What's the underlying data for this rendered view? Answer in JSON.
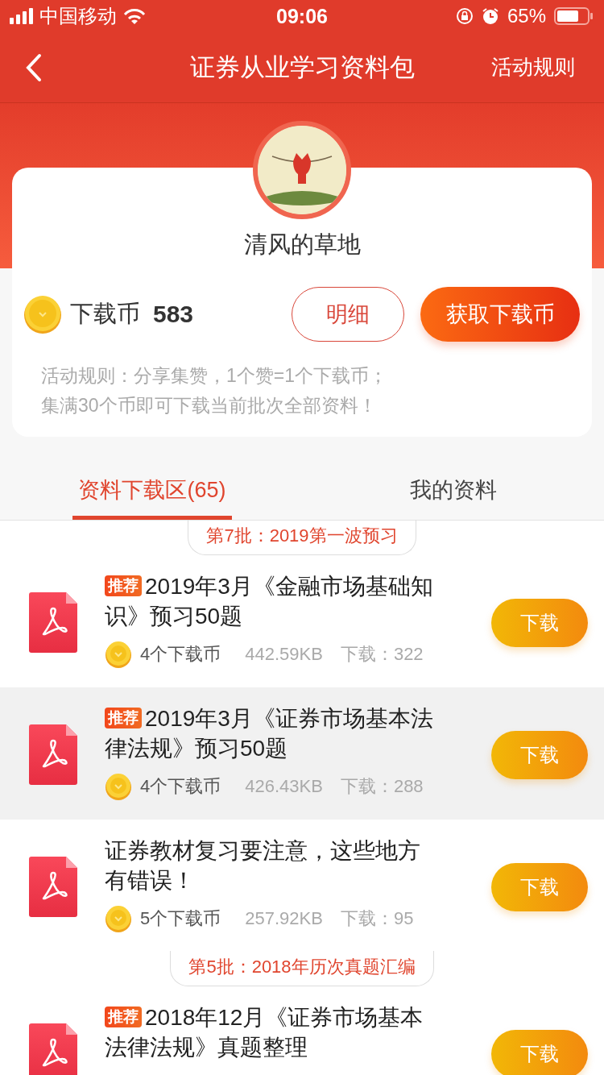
{
  "status_bar": {
    "carrier": "中国移动",
    "time": "09:06",
    "battery": "65%"
  },
  "nav": {
    "title": "证券从业学习资料包",
    "action": "活动规则"
  },
  "profile": {
    "name": "清风的草地",
    "coin_label": "下载币",
    "coin_count": "583",
    "detail_button": "明细",
    "get_button": "获取下载币",
    "rules": [
      "活动规则：分享集赞，1个赞=1个下载币；",
      "集满30个币即可下载当前批次全部资料！"
    ]
  },
  "tabs": [
    {
      "label": "资料下载区(65)",
      "selected": true
    },
    {
      "label": "我的资料",
      "selected": false
    }
  ],
  "batches": [
    {
      "title": "第7批：2019第一波预习",
      "items": [
        {
          "badge": "推荐",
          "title": "2019年3月《金融市场基础知识》预习50题",
          "price": "4个下载币",
          "size": "442.59KB",
          "downloads": "下载：322",
          "button": "下载",
          "selected": false
        },
        {
          "badge": "推荐",
          "title": "2019年3月《证券市场基本法律法规》预习50题",
          "price": "4个下载币",
          "size": "426.43KB",
          "downloads": "下载：288",
          "button": "下载",
          "selected": true
        },
        {
          "title": "证券教材复习要注意，这些地方有错误！",
          "price": "5个下载币",
          "size": "257.92KB",
          "downloads": "下载：95",
          "button": "下载",
          "selected": false
        }
      ]
    },
    {
      "title": "第5批：2018年历次真题汇编",
      "items": [
        {
          "badge": "推荐",
          "title": "2018年12月《证券市场基本法律法规》真题整理",
          "button": "下载",
          "selected": false
        }
      ]
    }
  ]
}
